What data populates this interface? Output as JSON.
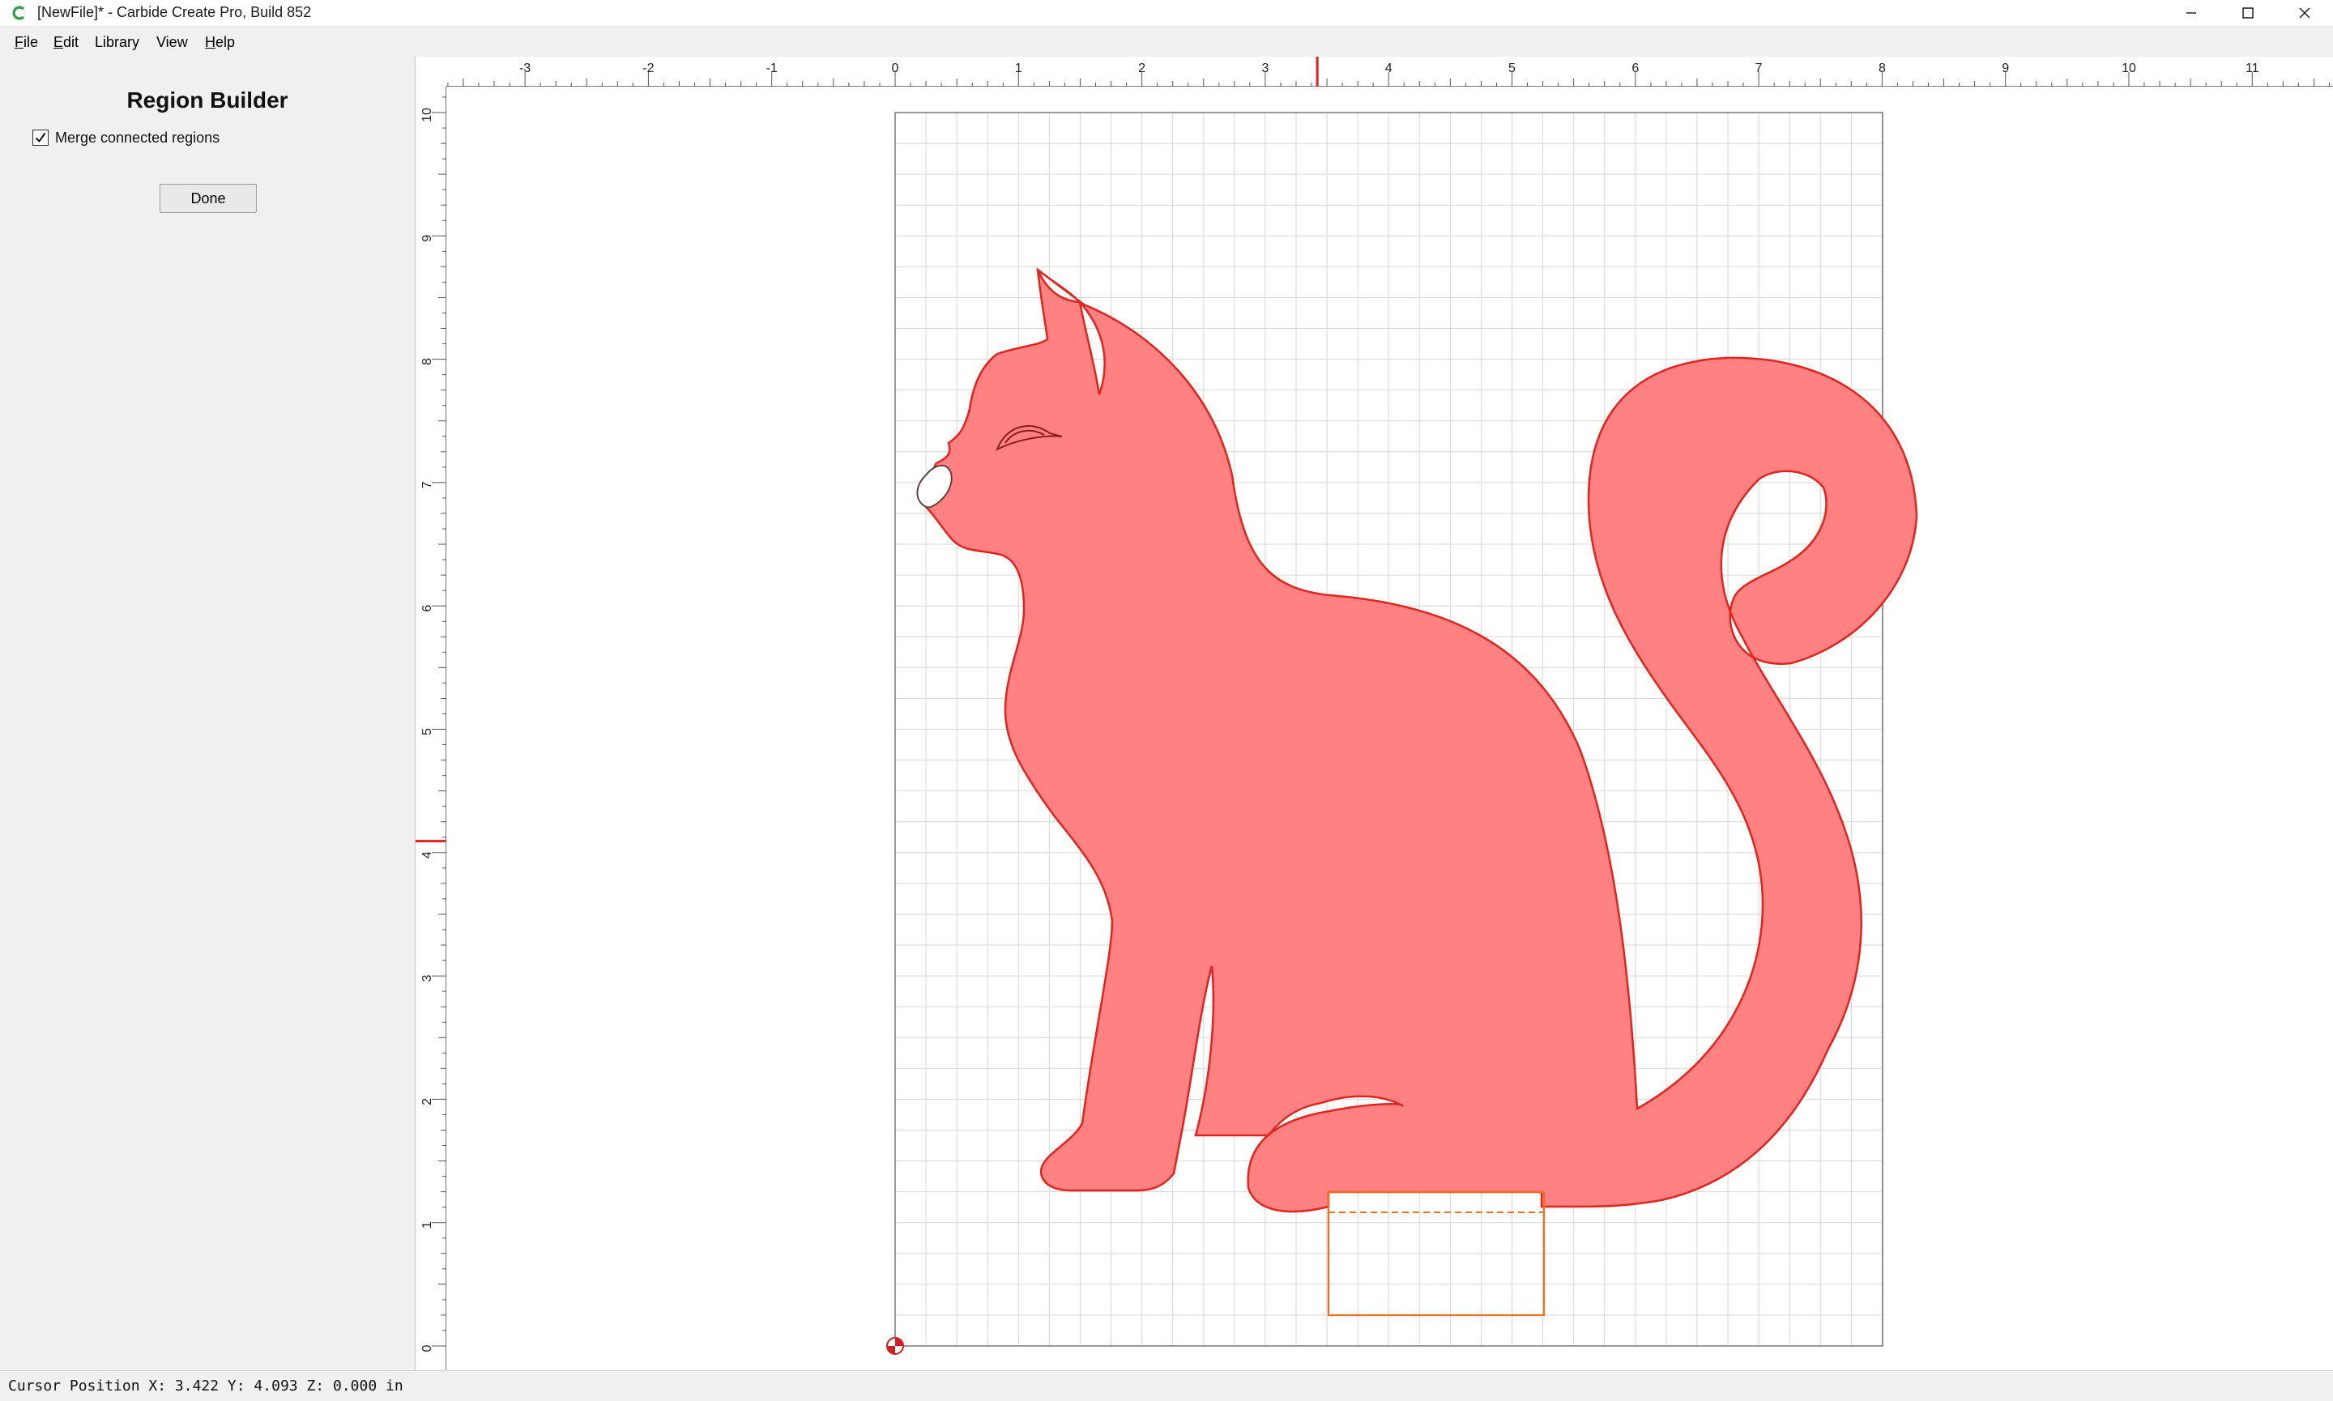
{
  "window": {
    "title": "[NewFile]* - Carbide Create Pro, Build 852",
    "controls": [
      "minimize-icon",
      "maximize-icon",
      "close-icon"
    ]
  },
  "menu": [
    {
      "label": "File",
      "mnemonic": "F",
      "rest": "ile"
    },
    {
      "label": "Edit",
      "mnemonic": "E",
      "rest": "dit"
    },
    {
      "label": "Library",
      "mnemonic": "",
      "rest": "Library"
    },
    {
      "label": "View",
      "mnemonic": "",
      "rest": "View"
    },
    {
      "label": "Help",
      "mnemonic": "H",
      "rest": "elp"
    }
  ],
  "region_builder": {
    "title": "Region Builder",
    "merge_label": "Merge connected regions",
    "merge_checked": true,
    "done_label": "Done"
  },
  "rulers": {
    "x_ticks": [
      "-3",
      "-2",
      "-1",
      "0",
      "1",
      "2",
      "3",
      "4",
      "5",
      "6",
      "7",
      "8",
      "9",
      "10",
      "11"
    ],
    "y_ticks": [
      "0",
      "1",
      "2",
      "3",
      "4",
      "5",
      "6",
      "7",
      "8",
      "9",
      "10"
    ],
    "cursor_marker_color": "#e02020"
  },
  "stock": {
    "width_in": 8,
    "height_in": 10,
    "grid_spacing_in": 0.25
  },
  "cursor": {
    "x": 3.422,
    "y": 4.093
  },
  "status": {
    "text": "Cursor Position X: 3.422 Y: 4.093 Z: 0.000 in"
  },
  "colors": {
    "region_fill": "#ff7c7c",
    "region_stroke": "#e0251f",
    "selection_rect": "#f07020",
    "grid": "#d6d6d6",
    "stock_border": "#777777"
  },
  "icons": {
    "app": "carbide-create-icon",
    "origin": "origin-marker-icon"
  }
}
